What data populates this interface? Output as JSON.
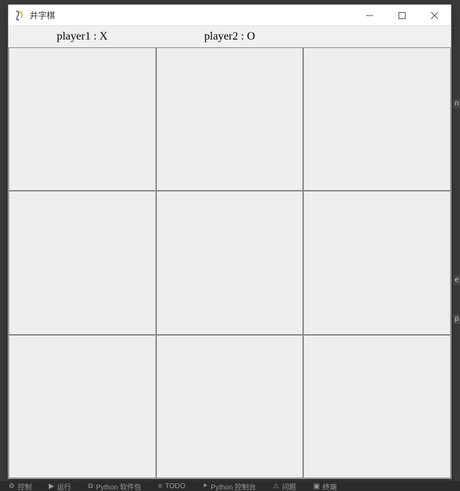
{
  "window": {
    "title": "井字棋"
  },
  "header": {
    "player1_label": "player1 : X",
    "player2_label": "player2 : O"
  },
  "board": {
    "cells": [
      "",
      "",
      "",
      "",
      "",
      "",
      "",
      "",
      ""
    ]
  },
  "bottom_bar": {
    "item1": "控制",
    "item2": "运行",
    "item3": "Python 软件包",
    "item4": "TODO",
    "item5": "Python 控制台",
    "item6": "问题",
    "item7": "终端"
  },
  "colors": {
    "window_bg": "#f0f0f0",
    "cell_bg": "#eeeeee",
    "grid_line": "#888888"
  }
}
